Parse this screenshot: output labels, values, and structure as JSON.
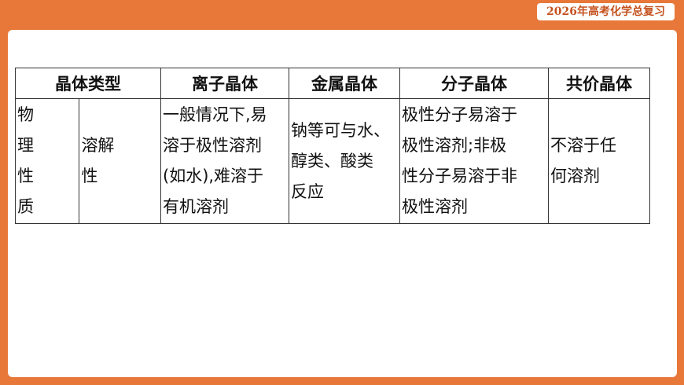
{
  "header": {
    "badge": "2026年高考化学总复习"
  },
  "table": {
    "headers": [
      "晶体类型",
      "离子晶体",
      "金属晶体",
      "分子晶体",
      "共价晶体"
    ],
    "row": {
      "category_chars": [
        "物",
        "理",
        "性",
        "质"
      ],
      "subcategory": "溶解\n性",
      "ionic": "一般情况下,易\n溶于极性溶剂\n(如水),难溶于\n有机溶剂",
      "metallic": "钠等可与水、\n醇类、酸类\n反应",
      "molecular": "极性分子易溶于\n极性溶剂;非极\n性分子易溶于非\n极性溶剂",
      "covalent": "不溶于任\n何溶剂"
    }
  }
}
